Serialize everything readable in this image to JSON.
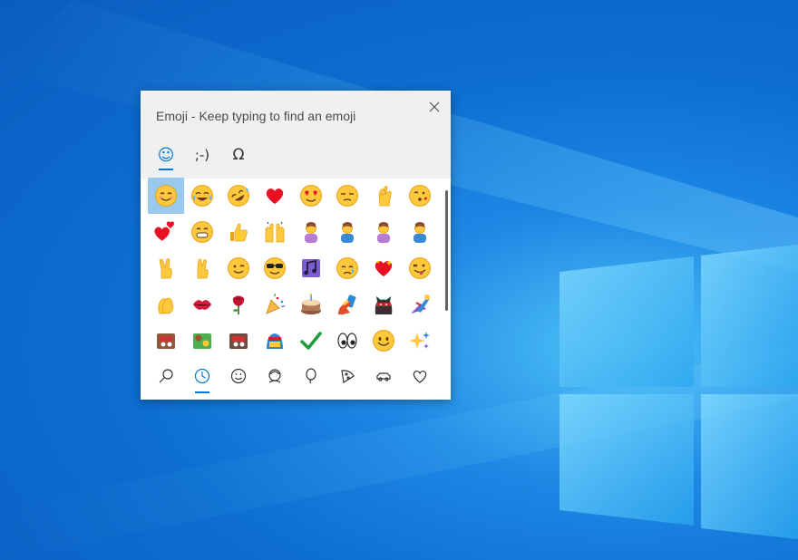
{
  "picker": {
    "title": "Emoji - Keep typing to find an emoji",
    "close_icon": "close-icon",
    "category_tabs": [
      {
        "label": "☺",
        "name": "emoji",
        "active": true
      },
      {
        "label": ";-)",
        "name": "kaomoji",
        "active": false
      },
      {
        "label": "Ω",
        "name": "symbols",
        "active": false
      }
    ],
    "emoji_grid": [
      [
        "smiling-face-blush",
        "tears-of-joy",
        "rolling-laughing",
        "red-heart",
        "heart-eyes",
        "unamused",
        "ok-hand",
        "kissing-face"
      ],
      [
        "two-hearts",
        "grinning-teeth",
        "thumbs-up",
        "raising-hands",
        "facepalm-woman",
        "facepalm-man",
        "shrug-woman",
        "shrug-man"
      ],
      [
        "victory-hand",
        "crossed-fingers",
        "winking-face",
        "sunglasses-face",
        "musical-notes",
        "crying-face",
        "sparkling-heart",
        "tongue-face"
      ],
      [
        "clapping-hands",
        "kiss-mark",
        "rose",
        "party-popper",
        "birthday-cake",
        "selfie",
        "ninja-cat",
        "superhero"
      ],
      [
        "sticker-1",
        "sticker-2",
        "sticker-3",
        "sticker-4",
        "check-mark",
        "eyes",
        "smiley-face",
        "sparkles"
      ]
    ],
    "selected_emoji": "smiling-face-blush",
    "bottom_nav": [
      {
        "name": "search",
        "icon": "search-icon",
        "active": false
      },
      {
        "name": "recent",
        "icon": "clock-icon",
        "active": true
      },
      {
        "name": "smileys",
        "icon": "smiley-icon",
        "active": false
      },
      {
        "name": "people",
        "icon": "person-icon",
        "active": false
      },
      {
        "name": "celebrations",
        "icon": "balloon-icon",
        "active": false
      },
      {
        "name": "food",
        "icon": "pizza-icon",
        "active": false
      },
      {
        "name": "travel",
        "icon": "car-icon",
        "active": false
      },
      {
        "name": "symbols",
        "icon": "heart-icon",
        "active": false
      }
    ]
  },
  "colors": {
    "accent": "#0078d4",
    "selected_bg": "#99c9ef",
    "header_bg": "#f0f0f0",
    "desktop_blue": "#0a5cc0"
  }
}
